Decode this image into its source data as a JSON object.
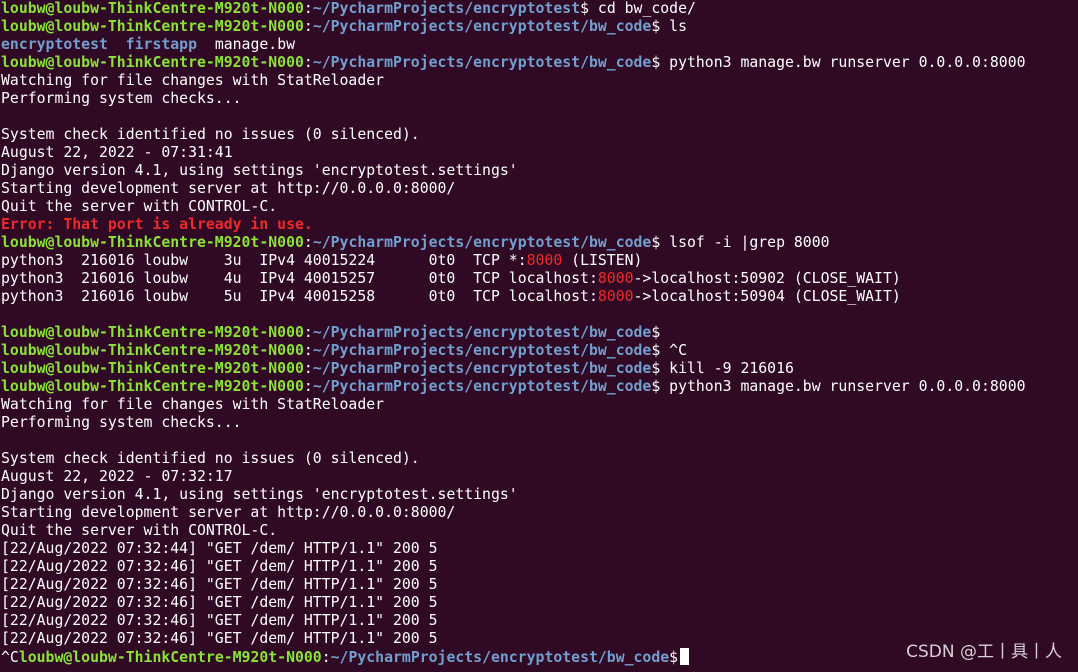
{
  "prompt": {
    "user_host": "loubw@loubw-ThinkCentre-M920t-N000",
    "colon": ":",
    "path_encryptotest": "~/PycharmProjects/encryptotest",
    "path_bw_code": "~/PycharmProjects/encryptotest/bw_code",
    "dollar": "$"
  },
  "colors": {
    "background": "#300a24",
    "prompt_user": "#8ae234",
    "prompt_path": "#729fcf",
    "error": "#ef2929",
    "text": "#ffffff"
  },
  "lines": {
    "l01_cmd": " cd bw_code/",
    "l02_cmd": " ls",
    "l03_dir1": "encryptotest",
    "l03_sep": "  ",
    "l03_dir2": "firstapp",
    "l03_file": "  manage.bw",
    "l04_cmd": " python3 manage.bw runserver 0.0.0.0:8000",
    "l05": "Watching for file changes with StatReloader",
    "l06": "Performing system checks...",
    "l07": "",
    "l08": "System check identified no issues (0 silenced).",
    "l09": "August 22, 2022 - 07:31:41",
    "l10": "Django version 4.1, using settings 'encryptotest.settings'",
    "l11": "Starting development server at http://0.0.0.0:8000/",
    "l12": "Quit the server with CONTROL-C.",
    "l13_error": "Error: That port is already in use.",
    "l14_cmd": " lsof -i |grep 8000",
    "l15_a": "python3  216016 loubw    3u  IPv4 40015224      0t0  TCP *:",
    "l15_hl": "8000",
    "l15_b": " (LISTEN)",
    "l16_a": "python3  216016 loubw    4u  IPv4 40015257      0t0  TCP localhost:",
    "l16_hl": "8000",
    "l16_b": "->localhost:50902 (CLOSE_WAIT)",
    "l17_a": "python3  216016 loubw    5u  IPv4 40015258      0t0  TCP localhost:",
    "l17_hl": "8000",
    "l17_b": "->localhost:50904 (CLOSE_WAIT)",
    "l18": "",
    "l19_cmd": "",
    "l20_cmd": " ^C",
    "l21_cmd": " kill -9 216016",
    "l22_cmd": " python3 manage.bw runserver 0.0.0.0:8000",
    "l23": "Watching for file changes with StatReloader",
    "l24": "Performing system checks...",
    "l25": "",
    "l26": "System check identified no issues (0 silenced).",
    "l27": "August 22, 2022 - 07:32:17",
    "l28": "Django version 4.1, using settings 'encryptotest.settings'",
    "l29": "Starting development server at http://0.0.0.0:8000/",
    "l30": "Quit the server with CONTROL-C.",
    "l31": "[22/Aug/2022 07:32:44] \"GET /dem/ HTTP/1.1\" 200 5",
    "l32": "[22/Aug/2022 07:32:46] \"GET /dem/ HTTP/1.1\" 200 5",
    "l33": "[22/Aug/2022 07:32:46] \"GET /dem/ HTTP/1.1\" 200 5",
    "l34": "[22/Aug/2022 07:32:46] \"GET /dem/ HTTP/1.1\" 200 5",
    "l35": "[22/Aug/2022 07:32:46] \"GET /dem/ HTTP/1.1\" 200 5",
    "l36": "[22/Aug/2022 07:32:46] \"GET /dem/ HTTP/1.1\" 200 5",
    "l37_prefix": "^C"
  },
  "watermark": "CSDN @工丨具丨人"
}
